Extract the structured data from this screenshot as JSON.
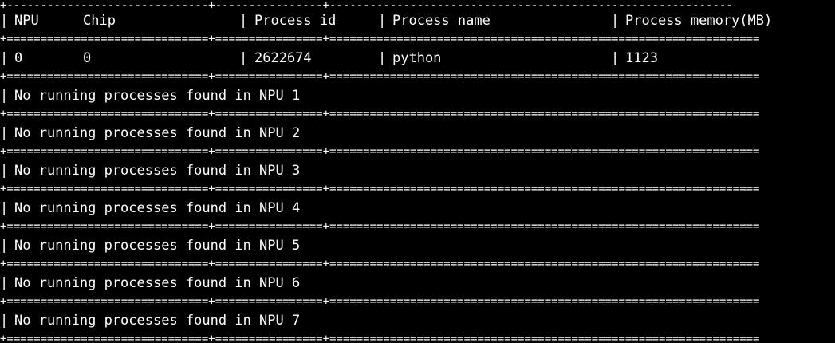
{
  "terminal": {
    "border_top": "+------------------------------+----------------+------------------------------------------------------------",
    "border_double": "+==============================+================+============================================================",
    "border_double_wide": "+==============================+================+================================================================",
    "pipe": "|",
    "header": {
      "npu": "NPU",
      "chip": "Chip",
      "process_id": "Process id",
      "process_name": "Process name",
      "process_memory": "Process memory(MB)"
    },
    "row": {
      "npu": "0",
      "chip": "0",
      "process_id": "2622674",
      "process_name": "python",
      "process_memory": "1123"
    },
    "no_process_messages": [
      "No running processes found in NPU 1",
      "No running processes found in NPU 2",
      "No running processes found in NPU 3",
      "No running processes found in NPU 4",
      "No running processes found in NPU 5",
      "No running processes found in NPU 6",
      "No running processes found in NPU 7"
    ]
  }
}
